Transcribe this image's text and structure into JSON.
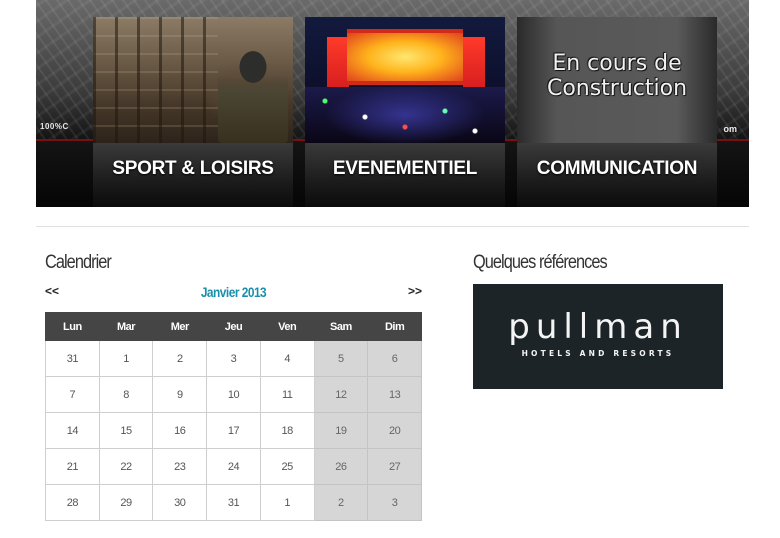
{
  "banner": {
    "brand_left": "100%C",
    "brand_right": "om",
    "tiles": [
      {
        "caption": "SPORT & LOISIRS"
      },
      {
        "caption": "EVENEMENTIEL"
      },
      {
        "caption": "COMMUNICATION",
        "placeholder_line1": "En cours de",
        "placeholder_line2": "Construction"
      }
    ]
  },
  "calendar": {
    "title": "Calendrier",
    "prev_label": "<<",
    "next_label": ">>",
    "month_label": "Janvier 2013",
    "month_color": "#1a8faa",
    "weekdays": [
      "Lun",
      "Mar",
      "Mer",
      "Jeu",
      "Ven",
      "Sam",
      "Dim"
    ],
    "weeks": [
      [
        "31",
        "1",
        "2",
        "3",
        "4",
        "5",
        "6"
      ],
      [
        "7",
        "8",
        "9",
        "10",
        "11",
        "12",
        "13"
      ],
      [
        "14",
        "15",
        "16",
        "17",
        "18",
        "19",
        "20"
      ],
      [
        "21",
        "22",
        "23",
        "24",
        "25",
        "26",
        "27"
      ],
      [
        "28",
        "29",
        "30",
        "31",
        "1",
        "2",
        "3"
      ]
    ]
  },
  "references": {
    "title": "Quelques références",
    "logo_name": "pullman",
    "logo_tagline": "HOTELS AND RESORTS"
  }
}
